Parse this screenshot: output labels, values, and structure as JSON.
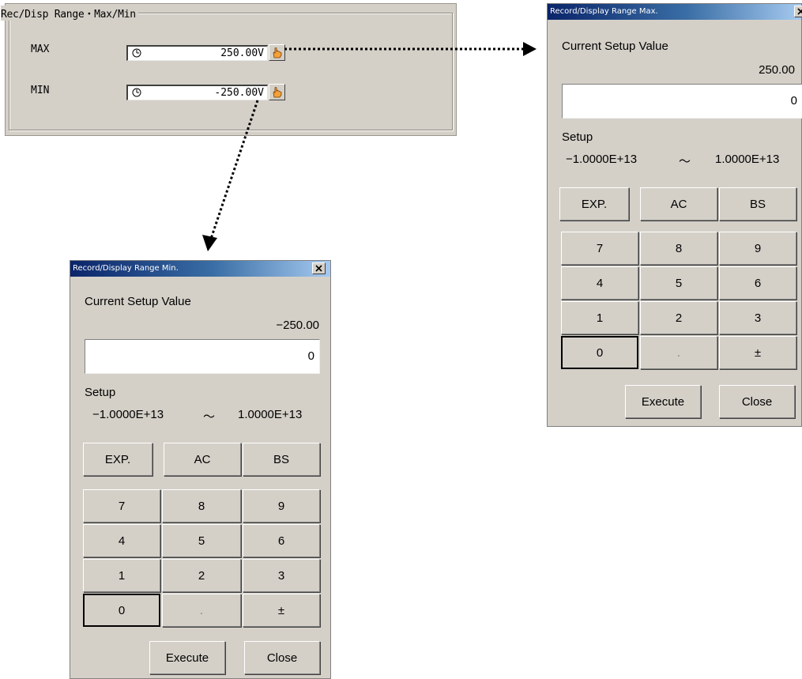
{
  "range_panel": {
    "legend": "Rec/Disp Range・Max/Min",
    "max": {
      "label": "MAX",
      "value": "250.00V"
    },
    "min": {
      "label": "MIN",
      "value": "-250.00V"
    }
  },
  "dialog_max": {
    "title": "Record/Display Range Max.",
    "current_label": "Current Setup Value",
    "current_value": "250.00",
    "input_value": "0",
    "setup_label": "Setup",
    "range_low": "−1.0000E+13",
    "range_sep": "～",
    "range_high": "1.0000E+13",
    "keys": {
      "exp": "EXP.",
      "ac": "AC",
      "bs": "BS",
      "k7": "7",
      "k8": "8",
      "k9": "9",
      "k4": "4",
      "k5": "5",
      "k6": "6",
      "k1": "1",
      "k2": "2",
      "k3": "3",
      "k0": "0",
      "dot": ".",
      "pm": "±"
    },
    "execute": "Execute",
    "close": "Close"
  },
  "dialog_min": {
    "title": "Record/Display Range Min.",
    "current_label": "Current Setup Value",
    "current_value": "−250.00",
    "input_value": "0",
    "setup_label": "Setup",
    "range_low": "−1.0000E+13",
    "range_sep": "～",
    "range_high": "1.0000E+13",
    "keys": {
      "exp": "EXP.",
      "ac": "AC",
      "bs": "BS",
      "k7": "7",
      "k8": "8",
      "k9": "9",
      "k4": "4",
      "k5": "5",
      "k6": "6",
      "k1": "1",
      "k2": "2",
      "k3": "3",
      "k0": "0",
      "dot": ".",
      "pm": "±"
    },
    "execute": "Execute",
    "close": "Close"
  },
  "icons": {
    "knob": "dial-icon",
    "pointer": "hand-pointer-icon",
    "close": "close-icon",
    "arrow": "dotted-arrow-icon"
  },
  "colors": {
    "face": "#d4d0c8",
    "title_start": "#0a246a",
    "title_end": "#a6caf0",
    "hand": "#f2a13a"
  }
}
